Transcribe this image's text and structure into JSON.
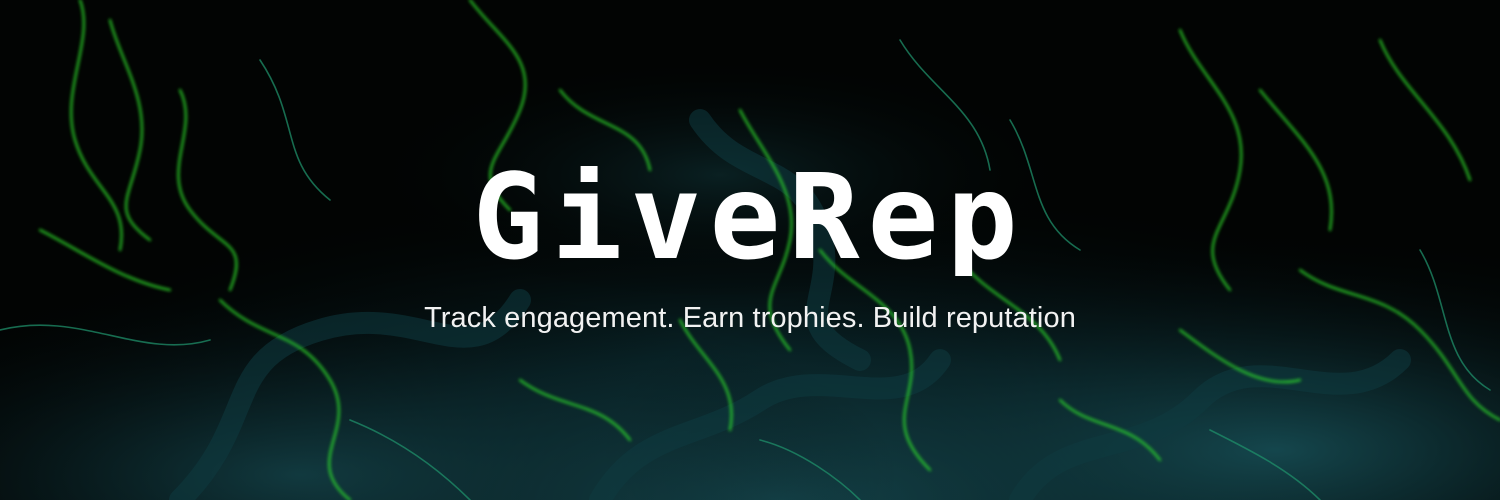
{
  "banner": {
    "logo_text": "GiveRep",
    "tagline": "Track engagement. Earn trophies. Build reputation"
  },
  "colors": {
    "background": "#020403",
    "swirl_dark": "#0b2b30",
    "swirl_teal": "#17525a",
    "swirl_green": "#2fe02b",
    "text": "#ffffff"
  }
}
